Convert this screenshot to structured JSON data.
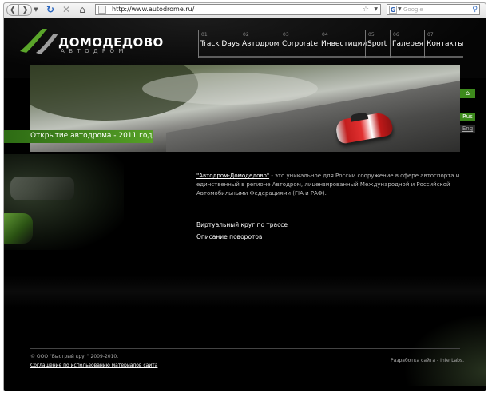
{
  "browser": {
    "url": "http://www.autodrome.ru/",
    "search_placeholder": "Google",
    "search_engine_letter": "G"
  },
  "site": {
    "logo": {
      "name": "ДОМОДЕДОВО",
      "subtitle": "АВТОДРОМ"
    },
    "menu": [
      {
        "num": "01",
        "label": "Track Days"
      },
      {
        "num": "02",
        "label": "Автодром"
      },
      {
        "num": "03",
        "label": "Corporate"
      },
      {
        "num": "04",
        "label": "Инвестиции"
      },
      {
        "num": "05",
        "label": "Sport"
      },
      {
        "num": "06",
        "label": "Галерея"
      },
      {
        "num": "07",
        "label": "Контакты"
      }
    ],
    "hero_caption": "Открытие автодрома - 2011 год",
    "lang": {
      "rus": "Rus",
      "eng": "Eng"
    },
    "intro": {
      "link_text": "\"Автодром-Домодедово\"",
      "text": " - это уникальное для России сооружение в сфере автоспорта и единственный в регионе Автодром, лицензированный Международной и Российской Автомобильными Федерациями (FIA и РАФ)."
    },
    "links": {
      "virtual_lap": "Виртуальный круг по трассе",
      "turns": "Описание поворотов"
    },
    "footer": {
      "copyright": "© ООО \"Быстрый круг\" 2009-2010.",
      "terms": "Соглашение по использованию материалов сайта",
      "developer": "Разработка сайта - InterLabs."
    }
  },
  "colors": {
    "accent_green": "#3d8a1c",
    "background": "#000000"
  }
}
